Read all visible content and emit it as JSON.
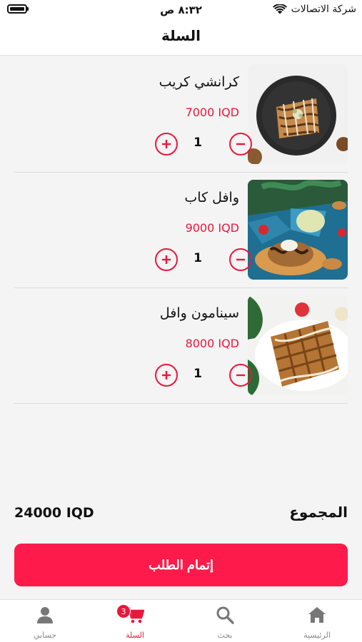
{
  "status_bar": {
    "time": "٨:٣٢ ص",
    "carrier": "شركة الاتصالات"
  },
  "header": {
    "title": "السلة"
  },
  "cart": {
    "items": [
      {
        "name": "كرانشي كريب",
        "price": "7000 IQD",
        "quantity": "1",
        "image": "crepe-photo"
      },
      {
        "name": "وافل كاب",
        "price": "9000 IQD",
        "quantity": "1",
        "image": "waffle-cup-photo"
      },
      {
        "name": "سينامون وافل",
        "price": "8000 IQD",
        "quantity": "1",
        "image": "cinnamon-waffle-photo"
      }
    ]
  },
  "summary": {
    "total_label": "المجموع",
    "total_value": "24000 IQD"
  },
  "checkout": {
    "label": "إتمام الطلب"
  },
  "tab_bar": {
    "tabs": [
      {
        "label": "حسابي",
        "icon": "person-icon"
      },
      {
        "label": "السلة",
        "icon": "cart-icon",
        "badge": "3",
        "active": true
      },
      {
        "label": "بحث",
        "icon": "search-icon"
      },
      {
        "label": "الرئيسية",
        "icon": "home-icon"
      }
    ]
  },
  "colors": {
    "accent": "#e8183d",
    "button": "#fe1a4a"
  }
}
